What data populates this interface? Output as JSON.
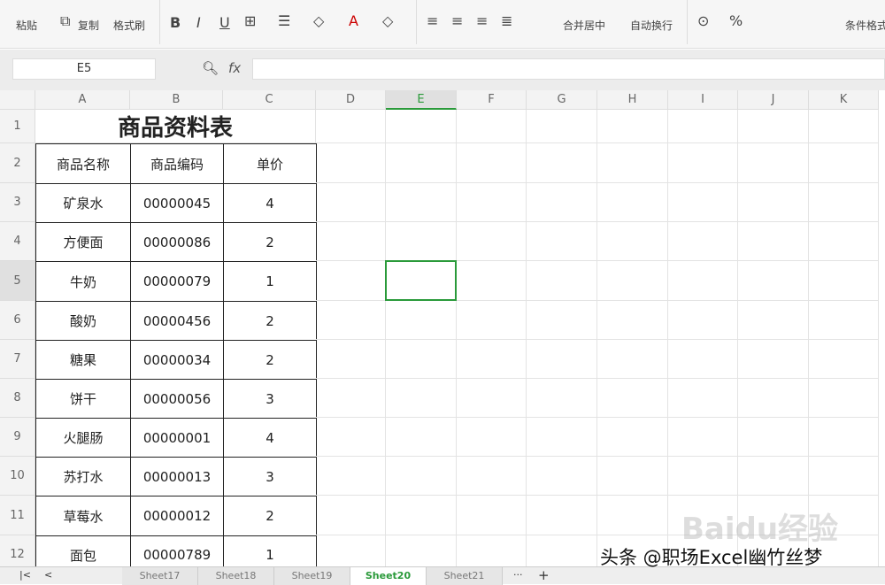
{
  "ribbon": {
    "paste": "粘贴",
    "copy": "复制",
    "format_painter": "格式刷",
    "bold": "B",
    "italic": "I",
    "underline": "U",
    "merge_center": "合并居中",
    "wrap_text": "自动换行",
    "percent": "%",
    "conditional_format": "条件格式"
  },
  "formula_bar": {
    "name_box": "E5",
    "fx": "fx",
    "value": ""
  },
  "columns": [
    "A",
    "B",
    "C",
    "D",
    "E",
    "F",
    "G",
    "H",
    "I",
    "J",
    "K"
  ],
  "selected_cell": "E5",
  "table": {
    "title": "商品资料表",
    "headers": [
      "商品名称",
      "商品编码",
      "单价"
    ],
    "rows": [
      [
        "矿泉水",
        "00000045",
        "4"
      ],
      [
        "方便面",
        "00000086",
        "2"
      ],
      [
        "牛奶",
        "00000079",
        "1"
      ],
      [
        "酸奶",
        "00000456",
        "2"
      ],
      [
        "糖果",
        "00000034",
        "2"
      ],
      [
        "饼干",
        "00000056",
        "3"
      ],
      [
        "火腿肠",
        "00000001",
        "4"
      ],
      [
        "苏打水",
        "00000013",
        "3"
      ],
      [
        "草莓水",
        "00000012",
        "2"
      ],
      [
        "面包",
        "00000789",
        "1"
      ]
    ]
  },
  "sheet_tabs": [
    "Sheet17",
    "Sheet18",
    "Sheet19",
    "Sheet20",
    "Sheet21"
  ],
  "active_sheet": "Sheet20",
  "watermark": "头条 @职场Excel幽竹丝梦",
  "baidu_watermark": "Baidu经验"
}
